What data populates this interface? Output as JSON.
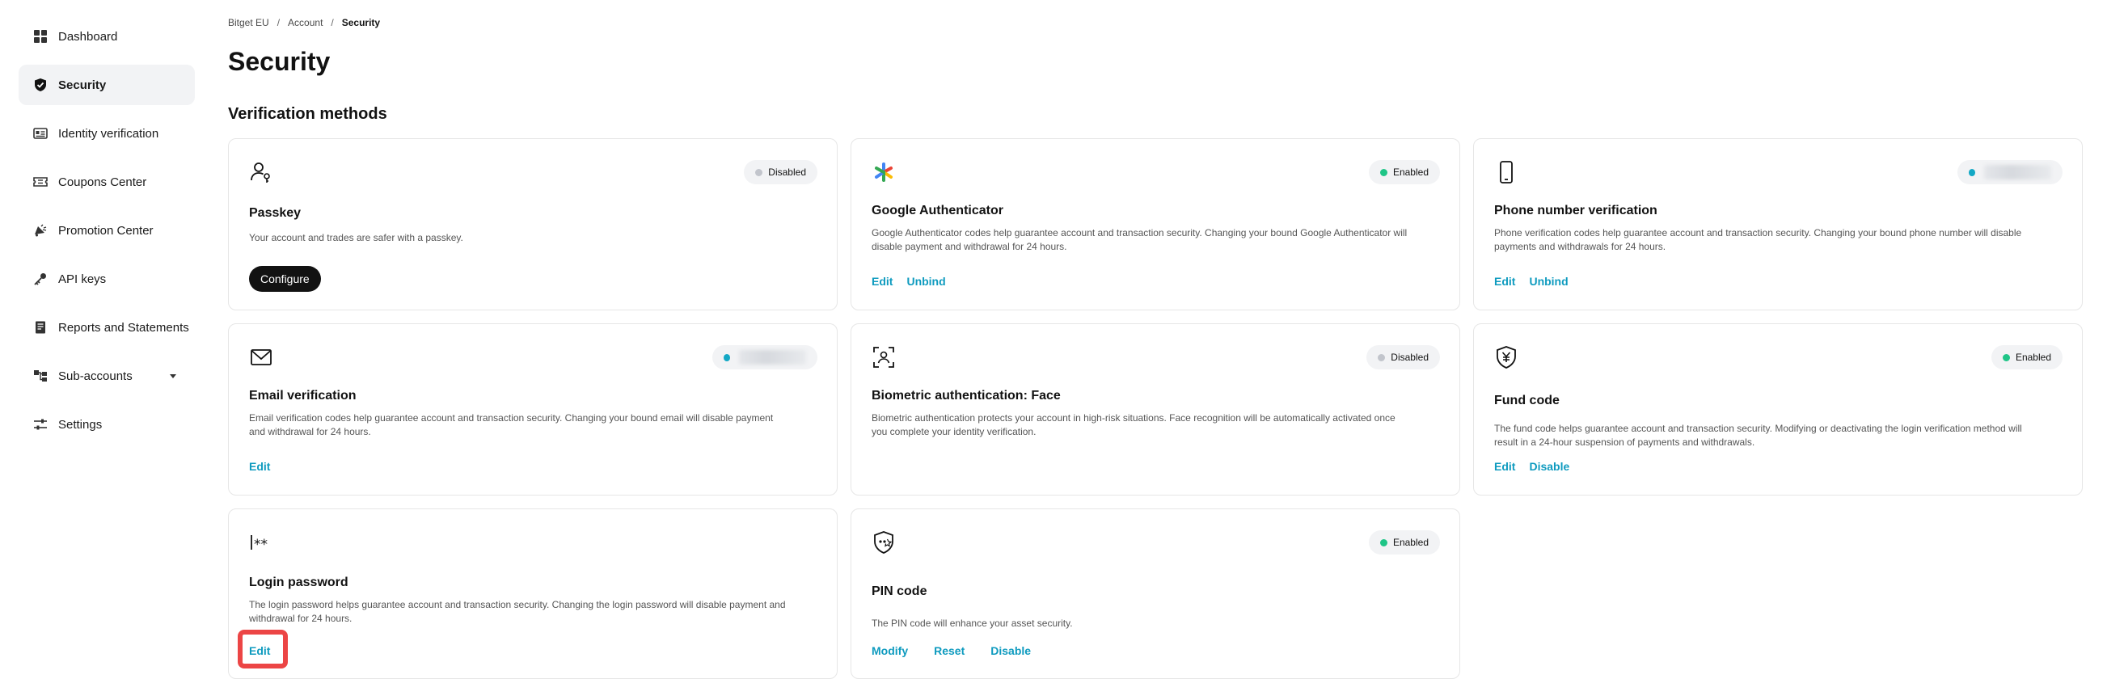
{
  "sidebar": {
    "items": [
      {
        "label": "Dashboard",
        "icon": "dashboard-icon"
      },
      {
        "label": "Security",
        "icon": "shield-icon",
        "active": true
      },
      {
        "label": "Identity verification",
        "icon": "id-card-icon"
      },
      {
        "label": "Coupons Center",
        "icon": "coupon-icon"
      },
      {
        "label": "Promotion Center",
        "icon": "megaphone-icon"
      },
      {
        "label": "API keys",
        "icon": "key-icon"
      },
      {
        "label": "Reports and Statements",
        "icon": "report-icon"
      },
      {
        "label": "Sub-accounts",
        "icon": "sub-accounts-icon"
      },
      {
        "label": "Settings",
        "icon": "settings-icon"
      }
    ]
  },
  "breadcrumb": {
    "items": [
      "Bitget EU",
      "Account",
      "Security"
    ],
    "separator": "/"
  },
  "page": {
    "title": "Security",
    "section_title": "Verification methods"
  },
  "colors": {
    "enabled": "#1fc587",
    "disabled": "#c2c5cc",
    "link": "#0f9bbf",
    "highlight": "#ec4545",
    "accent_teal": "#13a8c5"
  },
  "cards": {
    "passkey": {
      "title": "Passkey",
      "status": "Disabled",
      "desc": "Your account and trades are safer with a passkey.",
      "button": "Configure",
      "icon": "passkey-user-icon"
    },
    "google_auth": {
      "title": "Google Authenticator",
      "status": "Enabled",
      "desc": "Google Authenticator codes help guarantee account and transaction security. Changing your bound Google Authenticator will disable payment and withdrawal for 24 hours.",
      "actions": [
        "Edit",
        "Unbind"
      ],
      "icon": "google-authenticator-icon"
    },
    "phone": {
      "title": "Phone number verification",
      "desc": "Phone verification codes help guarantee account and transaction security. Changing your bound phone number will disable payments and withdrawals for 24 hours.",
      "actions": [
        "Edit",
        "Unbind"
      ],
      "icon": "phone-icon"
    },
    "email": {
      "title": "Email verification",
      "desc": "Email verification codes help guarantee account and transaction security. Changing your bound email will disable payment and withdrawal for 24 hours.",
      "actions": [
        "Edit"
      ],
      "icon": "mail-icon"
    },
    "biometric": {
      "title": "Biometric authentication: Face",
      "status": "Disabled",
      "desc": "Biometric authentication protects your account in high-risk situations. Face recognition will be automatically activated once you complete your identity verification.",
      "icon": "face-scan-icon"
    },
    "fund_code": {
      "title": "Fund code",
      "status": "Enabled",
      "desc": "The fund code helps guarantee account and transaction security. Modifying or deactivating the login verification method will result in a 24-hour suspension of payments and withdrawals.",
      "actions": [
        "Edit",
        "Disable"
      ],
      "icon": "fund-code-icon"
    },
    "login_password": {
      "title": "Login password",
      "desc": "The login password helps guarantee account and transaction security. Changing the login password will disable payment and withdrawal for 24 hours.",
      "actions": [
        "Edit"
      ],
      "icon": "password-icon"
    },
    "pin": {
      "title": "PIN code",
      "status": "Enabled",
      "desc": "The PIN code will enhance your asset security.",
      "actions": [
        "Modify",
        "Reset",
        "Disable"
      ],
      "icon": "pin-shield-icon"
    }
  }
}
